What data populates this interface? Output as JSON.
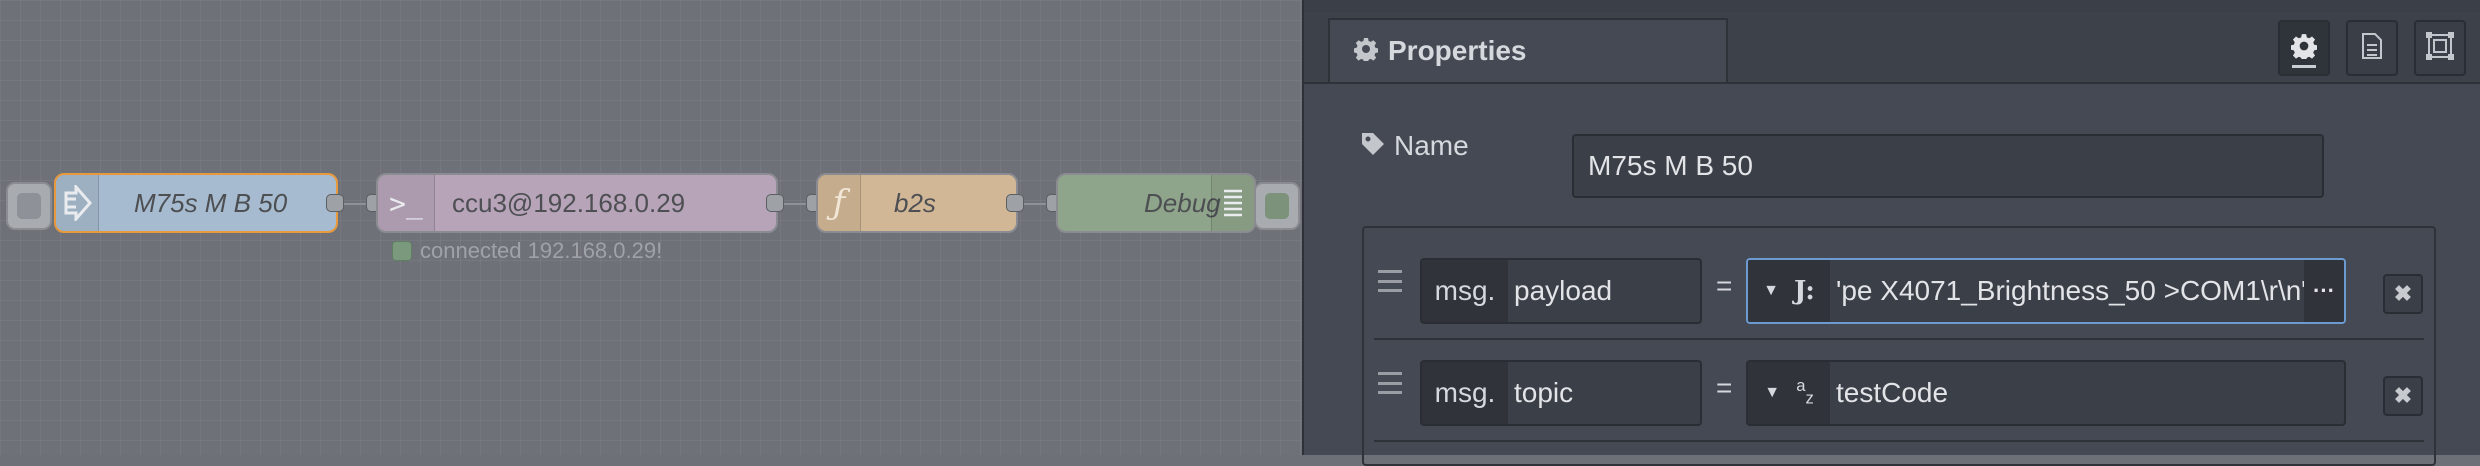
{
  "flow": {
    "nodes": [
      {
        "label": "M75s M B 50",
        "type": "inject"
      },
      {
        "label": "ccu3@192.168.0.29",
        "type": "exec"
      },
      {
        "label": "b2s",
        "type": "function"
      },
      {
        "label": "Debug",
        "type": "debug"
      }
    ],
    "exec_status": "connected 192.168.0.29!",
    "colors": {
      "inject": "#a6bbcf",
      "exec": "#b7a4b9",
      "function": "#d2b796",
      "debug": "#8fa58b",
      "selected_border": "#e8993b"
    }
  },
  "panel": {
    "tab_label": "Properties",
    "tab_icon": "gear-icon",
    "toolbar_icons": [
      "gear-icon",
      "document-icon",
      "frame-icon"
    ],
    "name_label": "Name",
    "name_value": "M75s M B 50",
    "rules": [
      {
        "prefix": "msg.",
        "property": "payload",
        "equals": "=",
        "type_icon": "json-icon",
        "value": "'pe X4071_Brightness_50 >COM1\\r\\n\""
      },
      {
        "prefix": "msg.",
        "property": "topic",
        "equals": "=",
        "type_icon": "string-az-icon",
        "value": "testCode"
      }
    ]
  }
}
